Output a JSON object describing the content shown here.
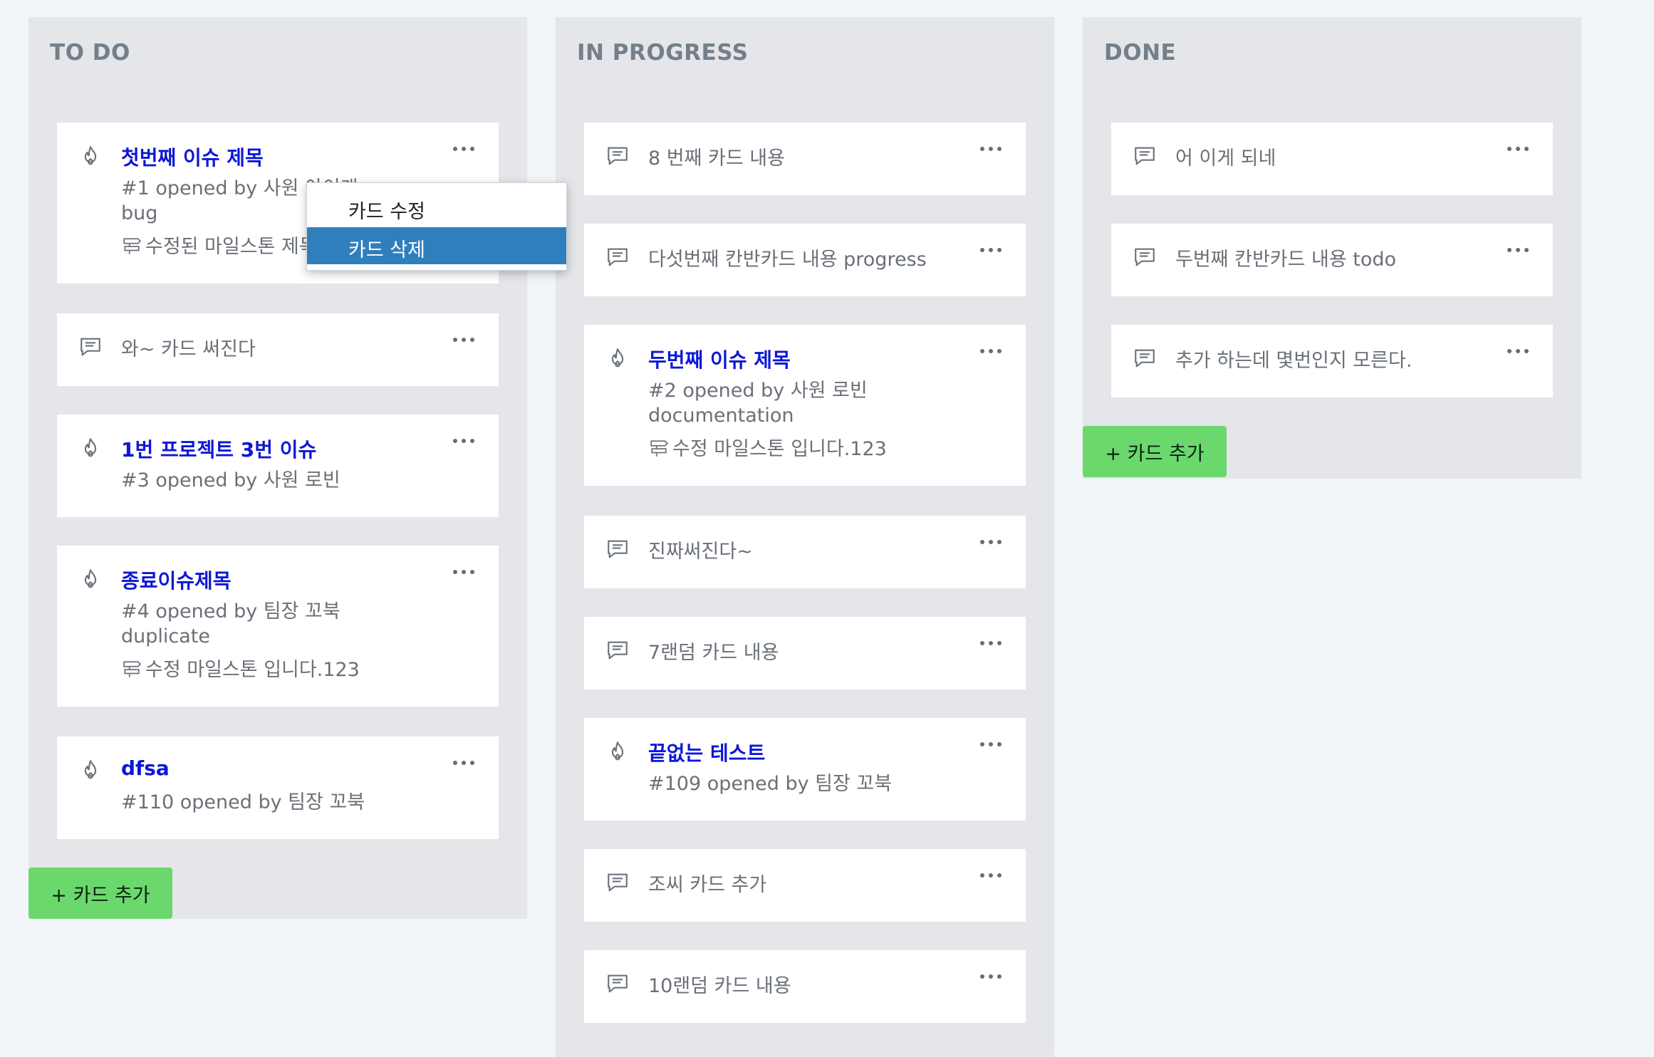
{
  "columns": [
    {
      "title": "TO DO",
      "add_label": "+ 카드 추가",
      "cards": [
        {
          "kind": "issue",
          "title": "첫번째 이슈 제목",
          "meta": "#1 opened by 사원 아이캐",
          "label": "bug",
          "milestone": "수정된 마일스톤 제목"
        },
        {
          "kind": "note",
          "text": "와~ 카드 써진다"
        },
        {
          "kind": "issue",
          "title": "1번 프로젝트 3번 이슈",
          "meta": "#3 opened by 사원 로빈"
        },
        {
          "kind": "issue",
          "title": "종료이슈제목",
          "meta": "#4 opened by 팀장 꼬북",
          "label": "duplicate",
          "milestone": "수정 마일스톤 입니다.123"
        },
        {
          "kind": "issue",
          "title": "dfsa",
          "meta": "#110 opened by 팀장 꼬북"
        }
      ]
    },
    {
      "title": "IN PROGRESS",
      "cards": [
        {
          "kind": "note",
          "text": "8 번째 카드 내용"
        },
        {
          "kind": "note",
          "text": "다섯번째 칸반카드 내용 progress"
        },
        {
          "kind": "issue",
          "title": "두번째 이슈 제목",
          "meta": "#2 opened by 사원 로빈",
          "label": "documentation",
          "milestone": "수정 마일스톤 입니다.123"
        },
        {
          "kind": "note",
          "text": "진짜써진다~"
        },
        {
          "kind": "note",
          "text": "7랜덤 카드 내용"
        },
        {
          "kind": "issue",
          "title": "끝없는 테스트",
          "meta": "#109 opened by 팀장 꼬북"
        },
        {
          "kind": "note",
          "text": "조씨 카드 추가"
        },
        {
          "kind": "note",
          "text": "10랜덤 카드 내용"
        }
      ]
    },
    {
      "title": "DONE",
      "add_label": "+ 카드 추가",
      "cards": [
        {
          "kind": "note",
          "text": "어 이게 되네"
        },
        {
          "kind": "note",
          "text": "두번째 칸반카드 내용 todo"
        },
        {
          "kind": "note",
          "text": "추가 하는데 몇번인지 모른다."
        }
      ]
    }
  ],
  "context_menu": {
    "items": [
      {
        "label": "카드 수정",
        "active": false
      },
      {
        "label": "카드 삭제",
        "active": true
      }
    ]
  },
  "icons": {
    "issue": "flame-icon",
    "note": "comment-icon",
    "more": "more-dots-icon",
    "milestone": "signpost-icon"
  },
  "colors": {
    "issue_title": "#0c17d6",
    "add_button": "#6bd86d",
    "menu_active": "#2f7fbd",
    "column_bg": "#e4e6e9"
  }
}
